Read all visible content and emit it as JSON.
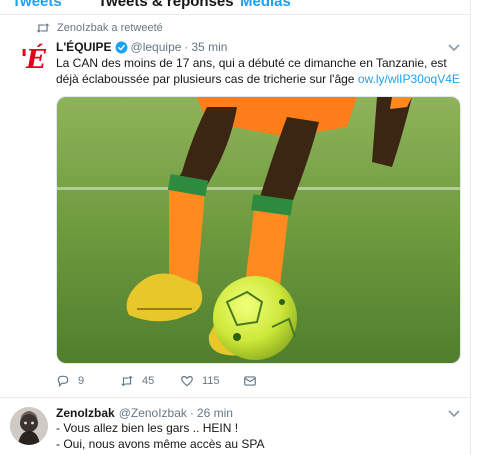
{
  "tabs": [
    {
      "label": "Tweets"
    },
    {
      "label": "Tweets & réponses"
    },
    {
      "label": "Médias"
    }
  ],
  "tweet1": {
    "retweeted_by": "ZenoIzbak a retweeté",
    "avatar_logo": "'É",
    "author_name": "L'ÉQUIPE",
    "verified": true,
    "handle": "@lequipe",
    "separator": "·",
    "time": "35 min",
    "text": "La CAN des moins de 17 ans, qui a débuté ce dimanche en Tanzanie, est déjà éclaboussée par plusieurs cas de tricherie sur l'âge",
    "link": "ow.ly/wlIP30oqV4E",
    "media_alt": "football-player-legs-with-ball",
    "actions": {
      "reply_count": "9",
      "retweet_count": "45",
      "like_count": "115"
    }
  },
  "tweet2": {
    "author_name": "ZenoIzbak",
    "handle": "@ZenoIzbak",
    "separator": "·",
    "time": "26 min",
    "lines": [
      "- Vous allez bien les gars .. HEIN !",
      "- Oui, nous avons même accès au SPA"
    ]
  },
  "colors": {
    "accent": "#1da1f2",
    "muted": "#657786",
    "brand_equipe": "#e2001a",
    "border": "#e6ecf0"
  },
  "icons": [
    "retweet-icon",
    "verified-icon",
    "chevron-down-icon",
    "reply-icon",
    "like-icon",
    "message-icon"
  ]
}
